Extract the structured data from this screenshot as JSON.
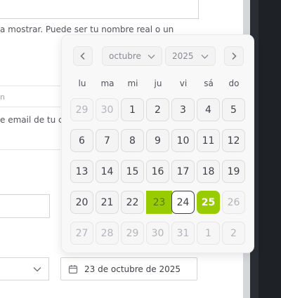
{
  "form": {
    "helper_text_1": "a mostrar. Puede ser tu nombre real o un",
    "email_hint_prefix": "n",
    "helper_text_2": "e email de tu cu",
    "date_input_value": "23 de octubre de 2025"
  },
  "calendar": {
    "month_label": "octubre",
    "year_label": "2025",
    "weekdays": [
      "lu",
      "ma",
      "mi",
      "ju",
      "vi",
      "sá",
      "do"
    ],
    "weeks": [
      [
        {
          "d": "29",
          "s": "outside"
        },
        {
          "d": "30",
          "s": "outside"
        },
        {
          "d": "1",
          "s": ""
        },
        {
          "d": "2",
          "s": ""
        },
        {
          "d": "3",
          "s": ""
        },
        {
          "d": "4",
          "s": ""
        },
        {
          "d": "5",
          "s": ""
        }
      ],
      [
        {
          "d": "6",
          "s": ""
        },
        {
          "d": "7",
          "s": ""
        },
        {
          "d": "8",
          "s": ""
        },
        {
          "d": "9",
          "s": ""
        },
        {
          "d": "10",
          "s": ""
        },
        {
          "d": "11",
          "s": ""
        },
        {
          "d": "12",
          "s": ""
        }
      ],
      [
        {
          "d": "13",
          "s": ""
        },
        {
          "d": "14",
          "s": ""
        },
        {
          "d": "15",
          "s": ""
        },
        {
          "d": "16",
          "s": ""
        },
        {
          "d": "17",
          "s": ""
        },
        {
          "d": "18",
          "s": ""
        },
        {
          "d": "19",
          "s": ""
        }
      ],
      [
        {
          "d": "20",
          "s": ""
        },
        {
          "d": "21",
          "s": ""
        },
        {
          "d": "22",
          "s": ""
        },
        {
          "d": "23",
          "s": "range"
        },
        {
          "d": "24",
          "s": "today"
        },
        {
          "d": "25",
          "s": "selected"
        },
        {
          "d": "26",
          "s": "outside"
        }
      ],
      [
        {
          "d": "27",
          "s": "outside"
        },
        {
          "d": "28",
          "s": "outside"
        },
        {
          "d": "29",
          "s": "outside"
        },
        {
          "d": "30",
          "s": "outside"
        },
        {
          "d": "31",
          "s": "outside"
        },
        {
          "d": "1",
          "s": "outside"
        },
        {
          "d": "2",
          "s": "outside"
        }
      ]
    ]
  },
  "colors": {
    "accent": "#99cc00",
    "app_sidebar": "#1e2227"
  },
  "icons": {
    "prev": "chevron-left-icon",
    "next": "chevron-right-icon",
    "dropdown": "chevron-down-icon",
    "date": "calendar-icon"
  }
}
